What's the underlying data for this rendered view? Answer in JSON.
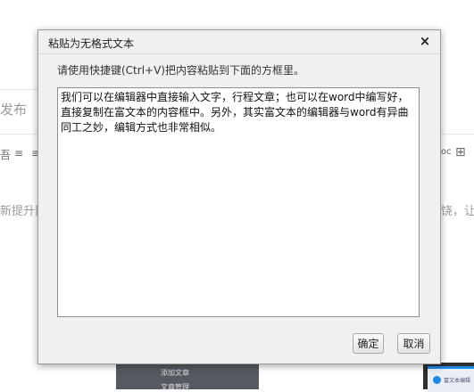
{
  "background": {
    "publish_text": "发布",
    "left_paragraph": "新提升阝",
    "right_paragraph": "饶，让",
    "toolbar_left": [
      "吾",
      "≡",
      "≡"
    ],
    "toolbar_right": [
      "oc",
      "⊞"
    ],
    "dark_block_items": [
      "添加文章",
      "文章管理"
    ],
    "thumb_text": "富文本编辑"
  },
  "dialog": {
    "title": "粘贴为无格式文本",
    "close_symbol": "×",
    "instruction": "请使用快捷键(Ctrl+V)把内容粘贴到下面的方框里。",
    "textarea_value": "我们可以在编辑器中直接输入文字，行程文章；也可以在word中编写好，直接复制在富文本的内容框中。另外，其实富文本的编辑器与word有异曲同工之妙，编辑方式也非常相似。",
    "ok_label": "确定",
    "cancel_label": "取消"
  }
}
